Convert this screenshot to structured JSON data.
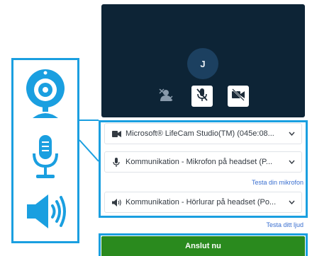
{
  "preview": {
    "avatar_initial": "J",
    "controls": [
      {
        "icon": "background-effects-icon"
      },
      {
        "icon": "mic-muted-icon"
      },
      {
        "icon": "camera-off-icon"
      }
    ]
  },
  "devices": {
    "camera": {
      "icon": "video-camera-icon",
      "value": "Microsoft® LifeCam Studio(TM) (045e:08..."
    },
    "microphone": {
      "icon": "microphone-icon",
      "value": "Kommunikation - Mikrofon på headset (P..."
    },
    "speaker": {
      "icon": "speaker-icon",
      "value": "Kommunikation - Hörlurar på headset (Po..."
    }
  },
  "links": {
    "test_mic": "Testa din mikrofon",
    "test_sound": "Testa ditt ljud"
  },
  "join_button": "Anslut nu",
  "illustration": {
    "icons": [
      "webcam-icon",
      "studio-microphone-icon",
      "speaker-volume-icon"
    ]
  },
  "colors": {
    "accent": "#1a9fe0",
    "video_bg": "#0d2436",
    "join": "#2a8a1e",
    "link": "#3a6fd0"
  }
}
